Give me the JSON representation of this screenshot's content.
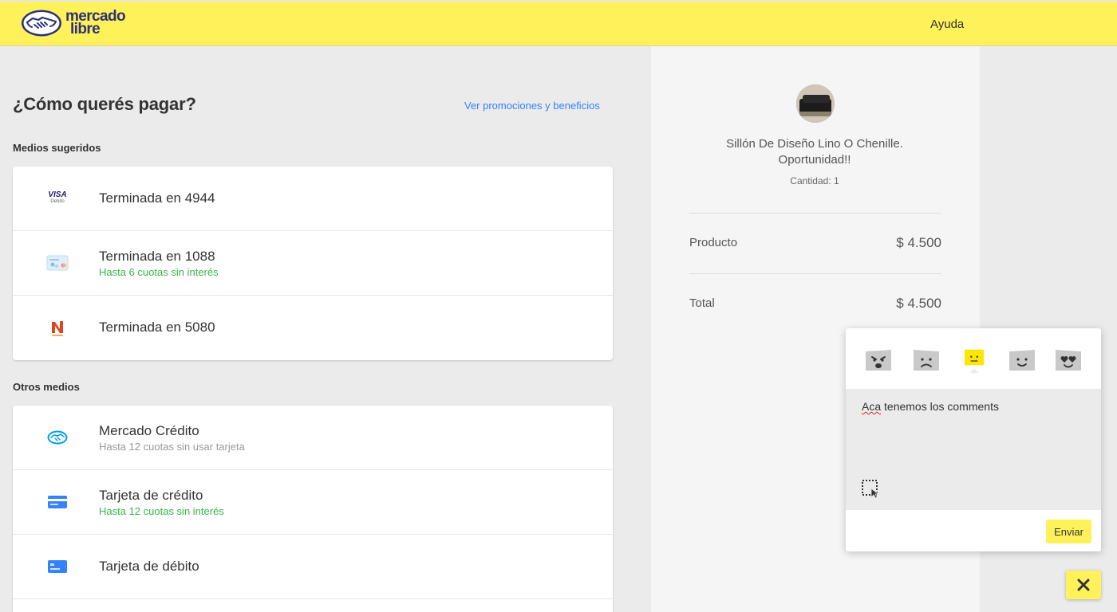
{
  "header": {
    "logo_line1": "mercado",
    "logo_line2": "libre",
    "help_label": "Ayuda"
  },
  "main": {
    "title": "¿Cómo querés pagar?",
    "promo_link": "Ver promociones y beneficios",
    "suggested_label": "Medios sugeridos",
    "suggested": [
      {
        "title": "Terminada en 4944",
        "subtitle": "",
        "icon": "visa-debit-icon"
      },
      {
        "title": "Terminada en 1088",
        "subtitle": "Hasta 6 cuotas sin interés",
        "icon": "card-generic-icon"
      },
      {
        "title": "Terminada en 5080",
        "subtitle": "",
        "icon": "naranja-icon"
      }
    ],
    "other_label": "Otros medios",
    "others": [
      {
        "title": "Mercado Crédito",
        "subtitle": "Hasta 12 cuotas sin usar tarjeta",
        "icon": "mercado-credito-icon"
      },
      {
        "title": "Tarjeta de crédito",
        "subtitle": "Hasta 12 cuotas sin interés",
        "icon": "credit-card-icon"
      },
      {
        "title": "Tarjeta de débito",
        "subtitle": "",
        "icon": "debit-card-icon"
      }
    ],
    "visa_text": "VISA",
    "visa_sub": "Debito"
  },
  "summary": {
    "product_name": "Sillón De Diseño Lino O Chenille. Oportunidad!!",
    "quantity": "Cantidad: 1",
    "product_label": "Producto",
    "product_value": "$ 4.500",
    "total_label": "Total",
    "total_value": "$ 4.500"
  },
  "feedback": {
    "emojis": [
      "angry-face-icon",
      "sad-face-icon",
      "neutral-face-icon",
      "happy-face-icon",
      "love-face-icon"
    ],
    "selected_index": 2,
    "comment_word1": "Aca",
    "comment_rest": " tenemos los comments",
    "send_label": "Enviar"
  },
  "colors": {
    "brand_yellow": "#fff159",
    "brand_blue": "#2d3277",
    "link_blue": "#3483fa",
    "green": "#39b54a"
  }
}
